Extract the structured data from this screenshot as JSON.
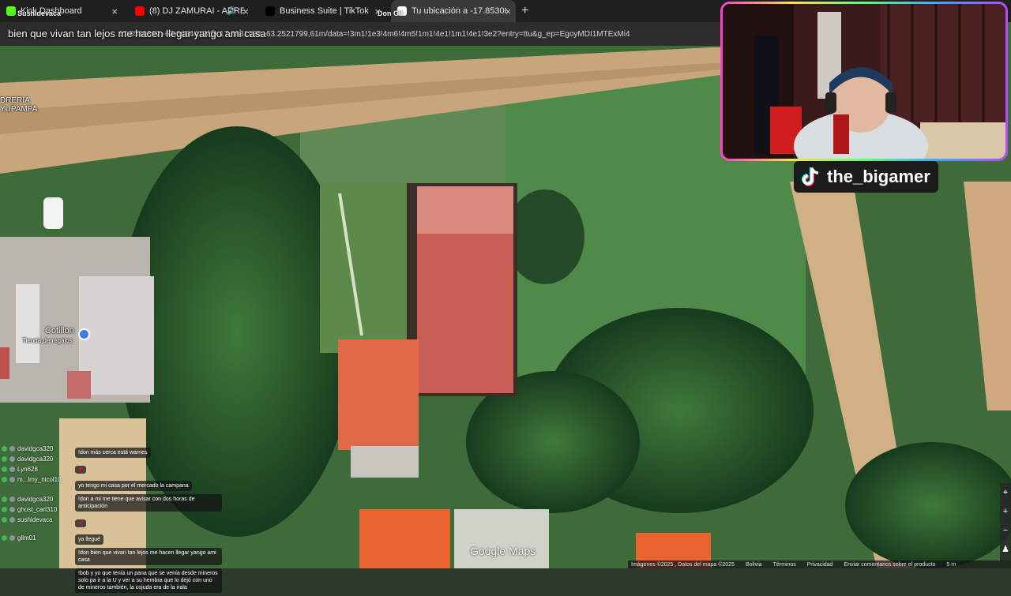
{
  "browser": {
    "tabs": [
      {
        "title": "Kick Dashboard",
        "favicon_color": "#53fc18",
        "active": false
      },
      {
        "title": "(8) DJ ZAMURAI - ARRECO...",
        "favicon_color": "#ff0000",
        "active": false
      },
      {
        "title": "Business Suite | TikTok",
        "favicon_color": "#000000",
        "active": false
      },
      {
        "title": "Tu ubicación a -17.8530897...",
        "favicon_color": "#ffffff",
        "active": true
      }
    ],
    "new_tab_label": "+",
    "url": "17.8530897,-63.0454417/@-17.8831988,-63.2521799,61m/data=!3m1!1e3!4m6!4m5!1m1!4e1!1m1!4e1!3e2?entry=ttu&g_ep=EgoyMDI1MTExMi4",
    "overlay_names": [
      "Sushidevaca",
      "Don Gil"
    ]
  },
  "caption_text": "bien que vivan tan lejos me hacen llegar yango ami casa",
  "map": {
    "labels": {
      "shop_top_left": "DRERIA\nYUPAMPA",
      "place_name": "Cotillon",
      "place_category": "Tienda de regalos"
    },
    "google_logo": "Google Maps",
    "attribution": [
      "Imágenes ©2025 , Datos del mapa ©2025",
      "Bolivia",
      "Términos",
      "Privacidad",
      "Enviar comentarios sobre el producto",
      "5 m"
    ],
    "zoom_in": "+",
    "zoom_out": "−"
  },
  "webcam": {
    "streamer_name": "the_bigamer",
    "border_colors": [
      "#ff3fd0",
      "#ffe04a",
      "#5bff7a",
      "#3fa8ff",
      "#b34bff"
    ]
  },
  "chat": {
    "users": [
      "davidgca320",
      "davidgca320",
      "Lyn628",
      "m...lmy_nicol10",
      "davidgca320",
      "ghost_carl310",
      "sushidevaca",
      "gllm01"
    ],
    "messages": [
      "!don más cerca está warnes",
      "",
      "yo tengo mi casa por el mercado la campana",
      "!don a mi me tiene que avisar con dos horas de anticipación",
      "",
      "ya llegué",
      "!don bien que vivan tan lejos me hacen llegar yango ami casa",
      "!bob y yo que tenía un pana que se venía desde mineros solo pa ir a la U y ver a su hembra que lo dejó con uno de mineros también, la cojuda era de la irala"
    ]
  }
}
